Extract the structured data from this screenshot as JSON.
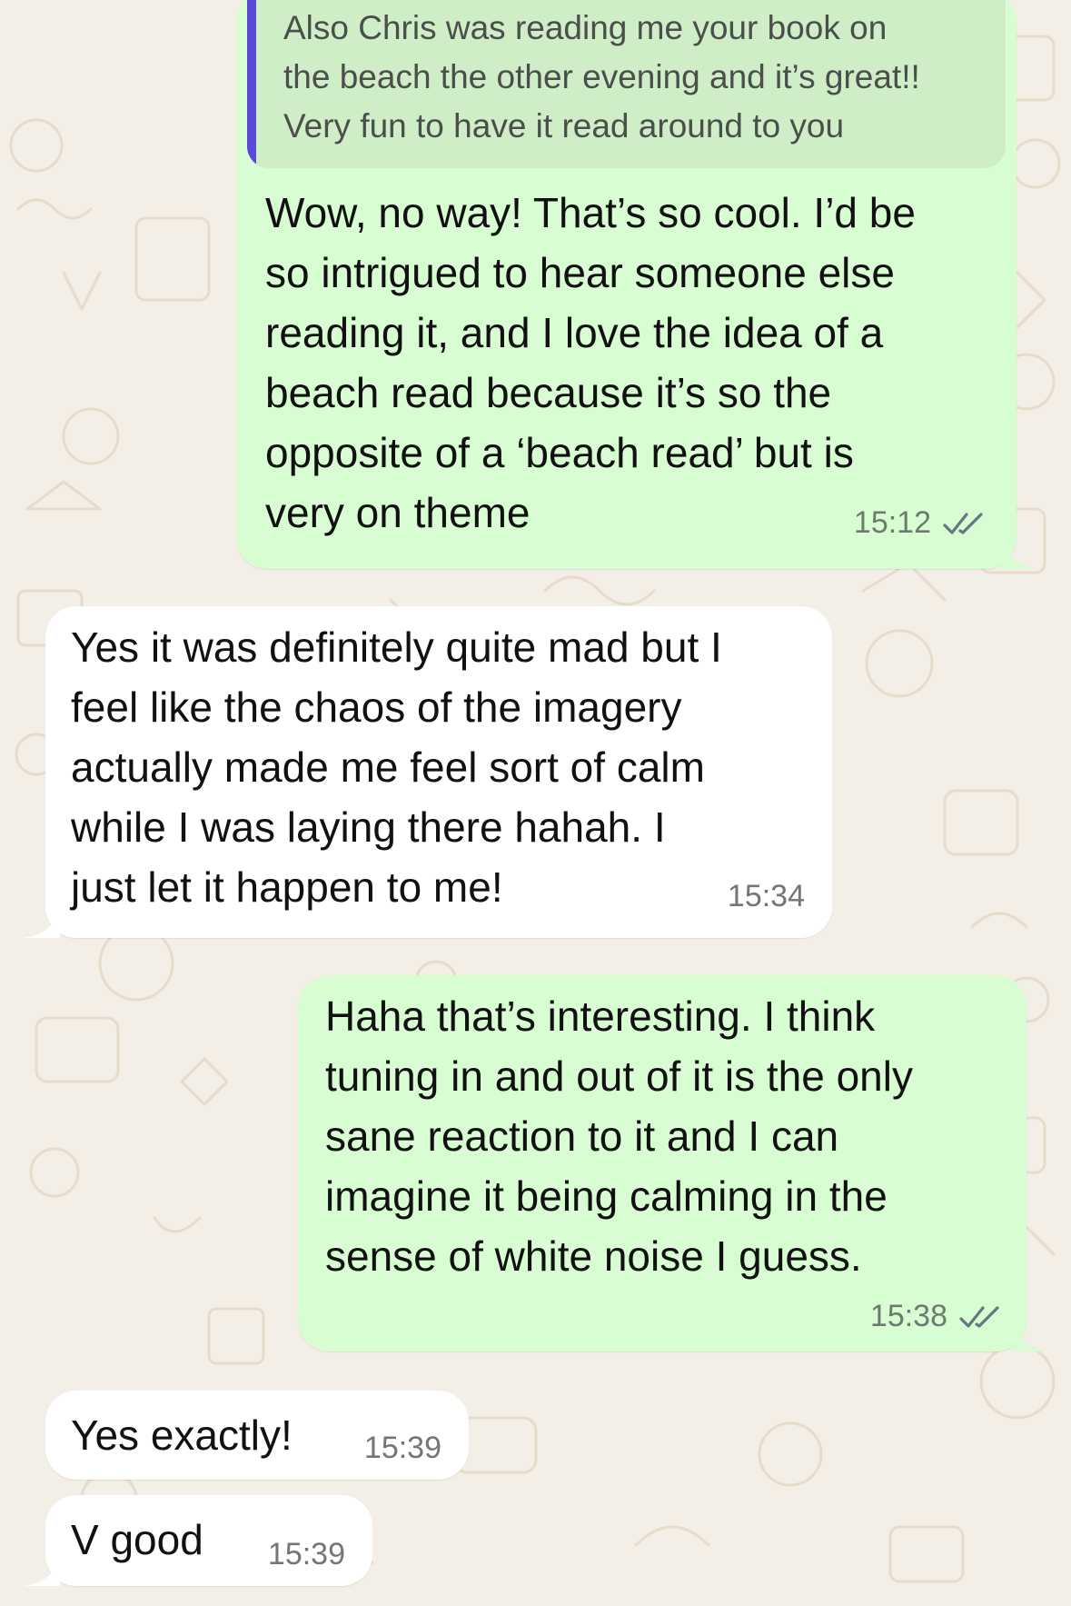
{
  "theme": {
    "wallpaper": "#f4efe6",
    "outgoing_bubble": "#d9fdd3",
    "incoming_bubble": "#ffffff",
    "quote_bar": "#5b49d8",
    "read_ticks": "#53bdeb"
  },
  "messages": [
    {
      "direction": "outgoing",
      "quoted": {
        "lines": [
          "Also Chris was reading me your book on",
          "the beach the other evening and it’s great!!",
          "Very fun to have it read around to you"
        ]
      },
      "lines": [
        "Wow, no way! That’s so cool. I’d be",
        "so intrigued to hear someone else",
        "reading it, and I love the idea of a",
        "beach read because it’s so the",
        "opposite of a ‘beach read’ but is",
        "very on theme"
      ],
      "time": "15:12",
      "status_icon": "double-check-icon"
    },
    {
      "direction": "incoming",
      "lines": [
        "Yes it was definitely quite mad but I",
        "feel like the chaos of the imagery",
        "actually made me feel sort of calm",
        "while I was laying there hahah. I",
        "just let it happen to me!"
      ],
      "time": "15:34"
    },
    {
      "direction": "outgoing",
      "lines": [
        "Haha that’s interesting. I think",
        "tuning in and out of it is the only",
        "sane reaction to it and I can",
        "imagine it being calming in the",
        "sense of white noise I guess."
      ],
      "time": "15:38",
      "status_icon": "double-check-icon"
    },
    {
      "direction": "incoming",
      "lines": [
        "Yes exactly!"
      ],
      "time": "15:39"
    },
    {
      "direction": "incoming",
      "lines": [
        "V good"
      ],
      "time": "15:39"
    }
  ]
}
